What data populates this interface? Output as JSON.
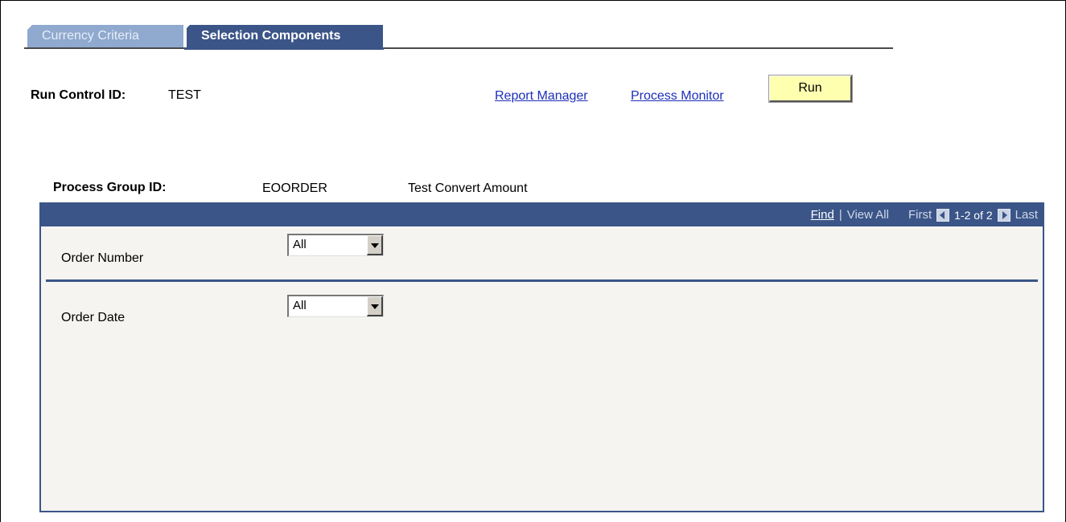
{
  "tabs": {
    "inactive_label": "Currency Criteria",
    "active_label": "Selection Components"
  },
  "run_control": {
    "label": "Run Control ID:",
    "value": "TEST"
  },
  "links": {
    "report_manager": "Report Manager",
    "process_monitor": "Process Monitor"
  },
  "run_button": {
    "label": "Run"
  },
  "process_group": {
    "label": "Process Group ID:",
    "value": "EOORDER",
    "description": "Test Convert Amount"
  },
  "grid": {
    "nav": {
      "find": "Find",
      "separator": "|",
      "view_all": "View All",
      "first": "First",
      "range": "1-2 of 2",
      "last": "Last"
    },
    "rows": [
      {
        "label": "Order Number",
        "selected": "All"
      },
      {
        "label": "Order Date",
        "selected": "All"
      }
    ]
  },
  "colors": {
    "accent": "#3b5588",
    "tab_inactive": "#8fa9cf",
    "run_button": "#ffffb0",
    "link": "#1c2fb8"
  }
}
